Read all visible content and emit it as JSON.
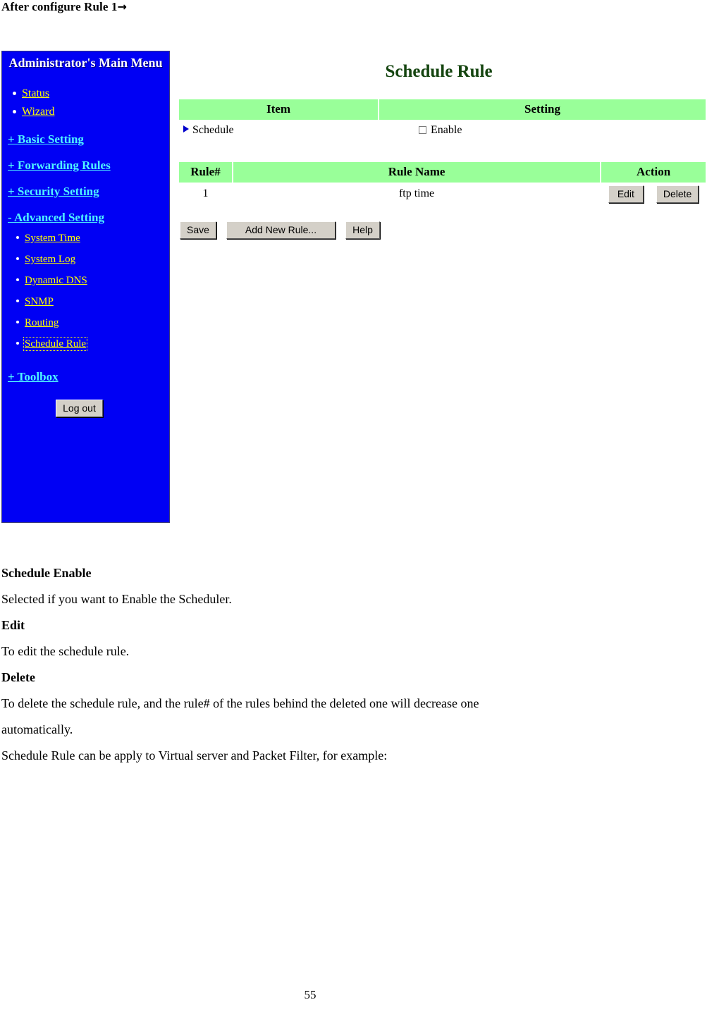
{
  "document": {
    "heading_text": "After configure Rule 1",
    "heading_arrow": "→",
    "page_number": "55"
  },
  "sidebar": {
    "title": "Administrator's Main Menu",
    "top_items": [
      {
        "label": "Status"
      },
      {
        "label": "Wizard"
      }
    ],
    "sections": [
      {
        "label": "+ Basic Setting"
      },
      {
        "label": "+ Forwarding Rules"
      },
      {
        "label": "+ Security Setting"
      },
      {
        "label": "- Advanced Setting"
      }
    ],
    "advanced_items": [
      {
        "label": "System Time"
      },
      {
        "label": "System Log"
      },
      {
        "label": "Dynamic DNS"
      },
      {
        "label": "SNMP"
      },
      {
        "label": "Routing"
      },
      {
        "label": "Schedule Rule"
      }
    ],
    "toolbox_label": "+ Toolbox",
    "logout_label": "Log out",
    "colors": {
      "background": "#0000f4",
      "link_yellow": "#ffff00",
      "link_cyan": "#4ff6ff",
      "title_text": "#ffffff"
    }
  },
  "main": {
    "page_title": "Schedule Rule",
    "title_color": "#14440f",
    "header_bg": "#99ff99",
    "settings_table": {
      "headers": {
        "item": "Item",
        "setting": "Setting"
      },
      "rows": [
        {
          "item": "Schedule",
          "setting_label": "Enable",
          "checked": false
        }
      ]
    },
    "rules_table": {
      "headers": {
        "rule_num": "Rule#",
        "rule_name": "Rule Name",
        "action": "Action"
      },
      "rows": [
        {
          "rule_num": "1",
          "rule_name": "ftp time",
          "edit": "Edit",
          "delete": "Delete"
        }
      ]
    },
    "toolbar": {
      "save_label": "Save",
      "add_new_rule_label": "Add New Rule...",
      "help_label": "Help"
    }
  },
  "descriptions": [
    {
      "term": "Schedule Enable",
      "text": "Selected if you want to Enable the Scheduler."
    },
    {
      "term": "Edit",
      "text": "To edit the schedule rule."
    },
    {
      "term": "Delete",
      "text": "To delete the schedule rule, and the rule# of the rules behind the deleted one will decrease one"
    }
  ],
  "trailing_lines": [
    "automatically.",
    "Schedule Rule can be apply to Virtual server and Packet Filter, for example:"
  ]
}
